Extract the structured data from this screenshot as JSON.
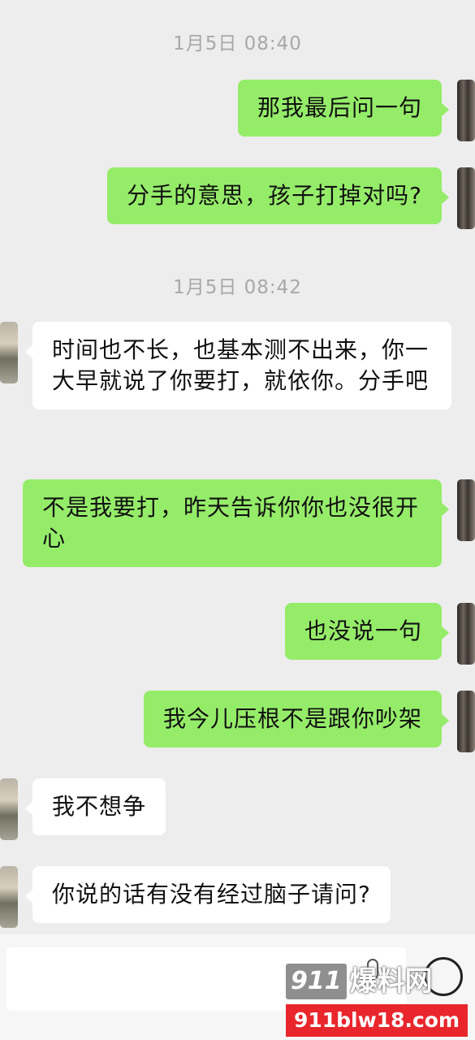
{
  "chat": {
    "timestamps": [
      "1月5日 08:40",
      "1月5日 08:42"
    ],
    "messages": [
      {
        "side": "out",
        "text": "那我最后问一句"
      },
      {
        "side": "out",
        "text": "分手的意思，孩子打掉对吗?"
      },
      {
        "side": "in",
        "text": "时间也不长，也基本测不出来，你一大早就说了你要打，就依你。分手吧"
      },
      {
        "side": "out",
        "text": "不是我要打，昨天告诉你你也没很开心"
      },
      {
        "side": "out",
        "text": "也没说一句"
      },
      {
        "side": "out",
        "text": "我今儿压根不是跟你吵架"
      },
      {
        "side": "in",
        "text": "我不想争"
      },
      {
        "side": "in",
        "text": "你说的话有没有经过脑子请问?"
      }
    ]
  },
  "input": {
    "value": ""
  },
  "watermark": {
    "number": "911",
    "cn": "爆料网",
    "url": "911blw18.com"
  },
  "colors": {
    "outgoing_bubble": "#95ec69",
    "incoming_bubble": "#ffffff",
    "background": "#ededed",
    "watermark_red": "#e8262c"
  },
  "icons": {
    "emoji": "emoji-smile-icon"
  }
}
